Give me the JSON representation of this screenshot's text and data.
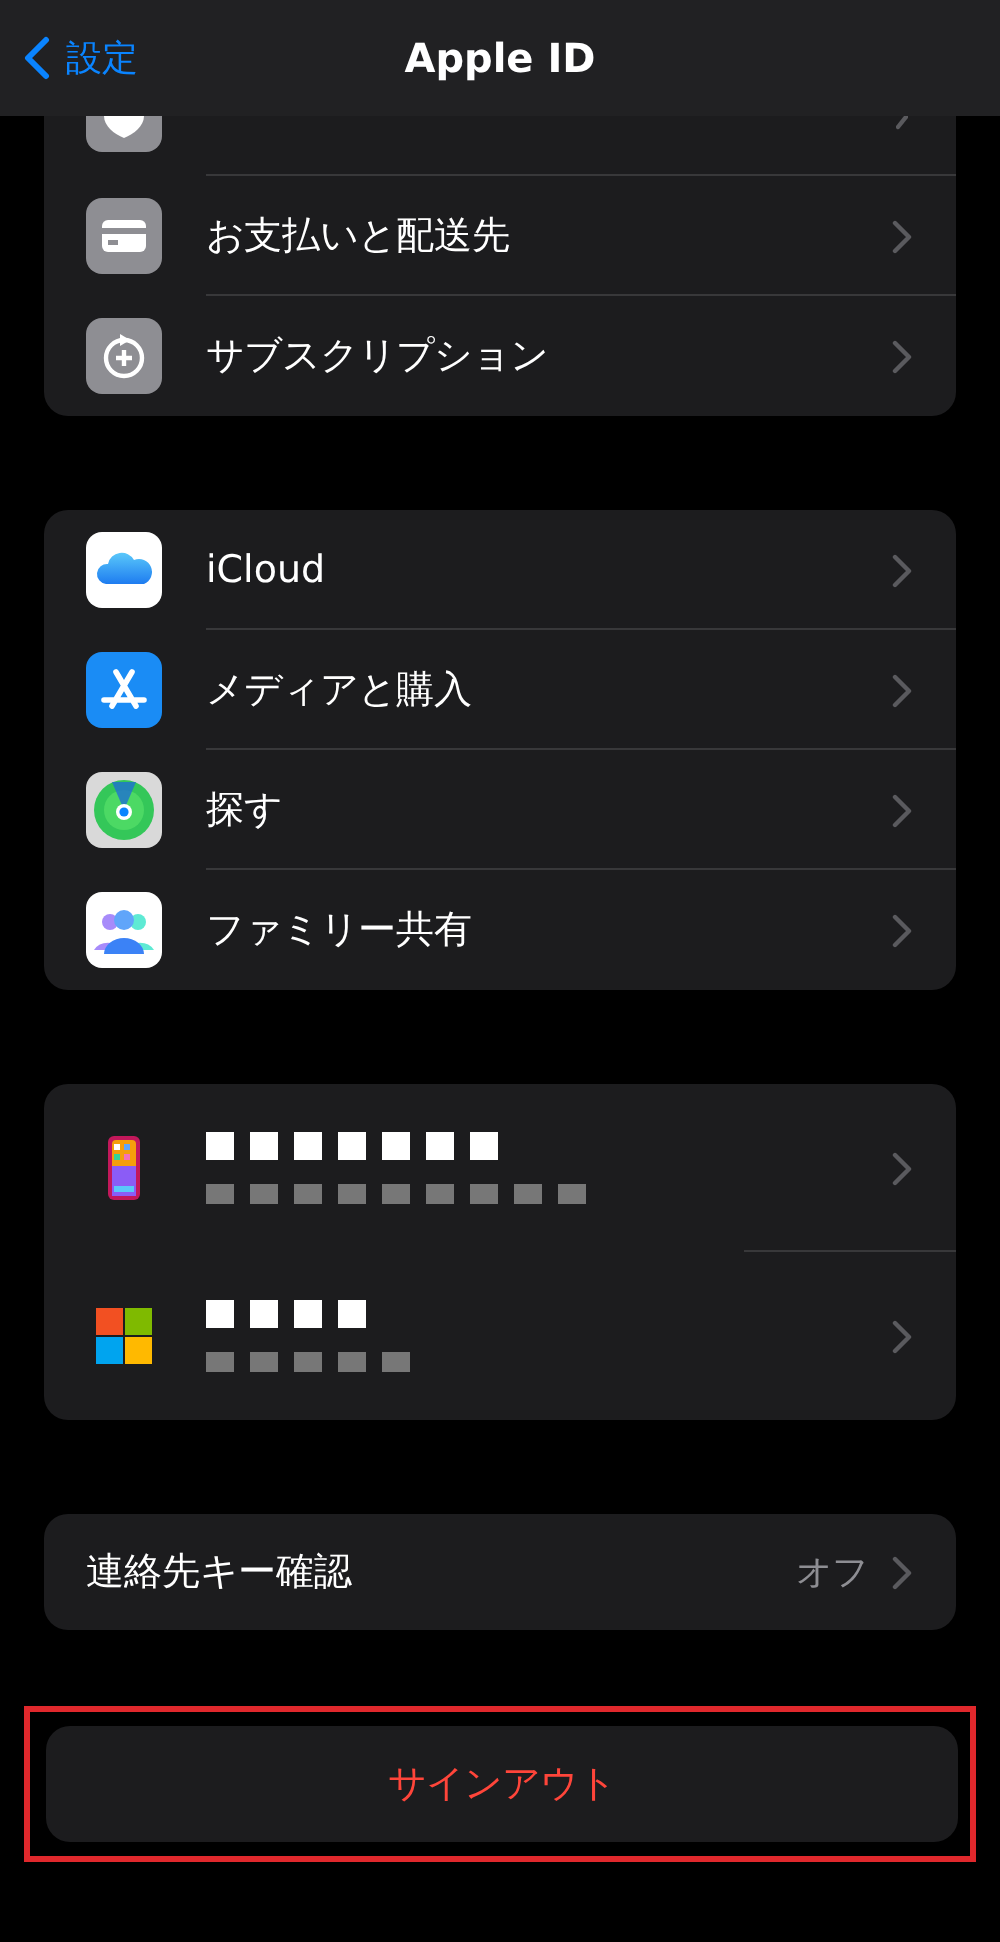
{
  "nav": {
    "back": "設定",
    "title": "Apple ID"
  },
  "groups": [
    {
      "cut_off_top": true,
      "rows": [
        {
          "label": "お支払いと配送先"
        },
        {
          "label": "サブスクリプション"
        }
      ]
    },
    {
      "rows": [
        {
          "label": "iCloud"
        },
        {
          "label": "メディアと購入"
        },
        {
          "label": "探す"
        },
        {
          "label": "ファミリー共有"
        }
      ]
    }
  ],
  "devices": [
    {
      "kind": "phone",
      "redacted": true
    },
    {
      "kind": "windows",
      "redacted": true
    }
  ],
  "contact_key": {
    "label": "連絡先キー確認",
    "value": "オフ"
  },
  "sign_out": {
    "label": "サインアウト",
    "highlighted": true
  }
}
